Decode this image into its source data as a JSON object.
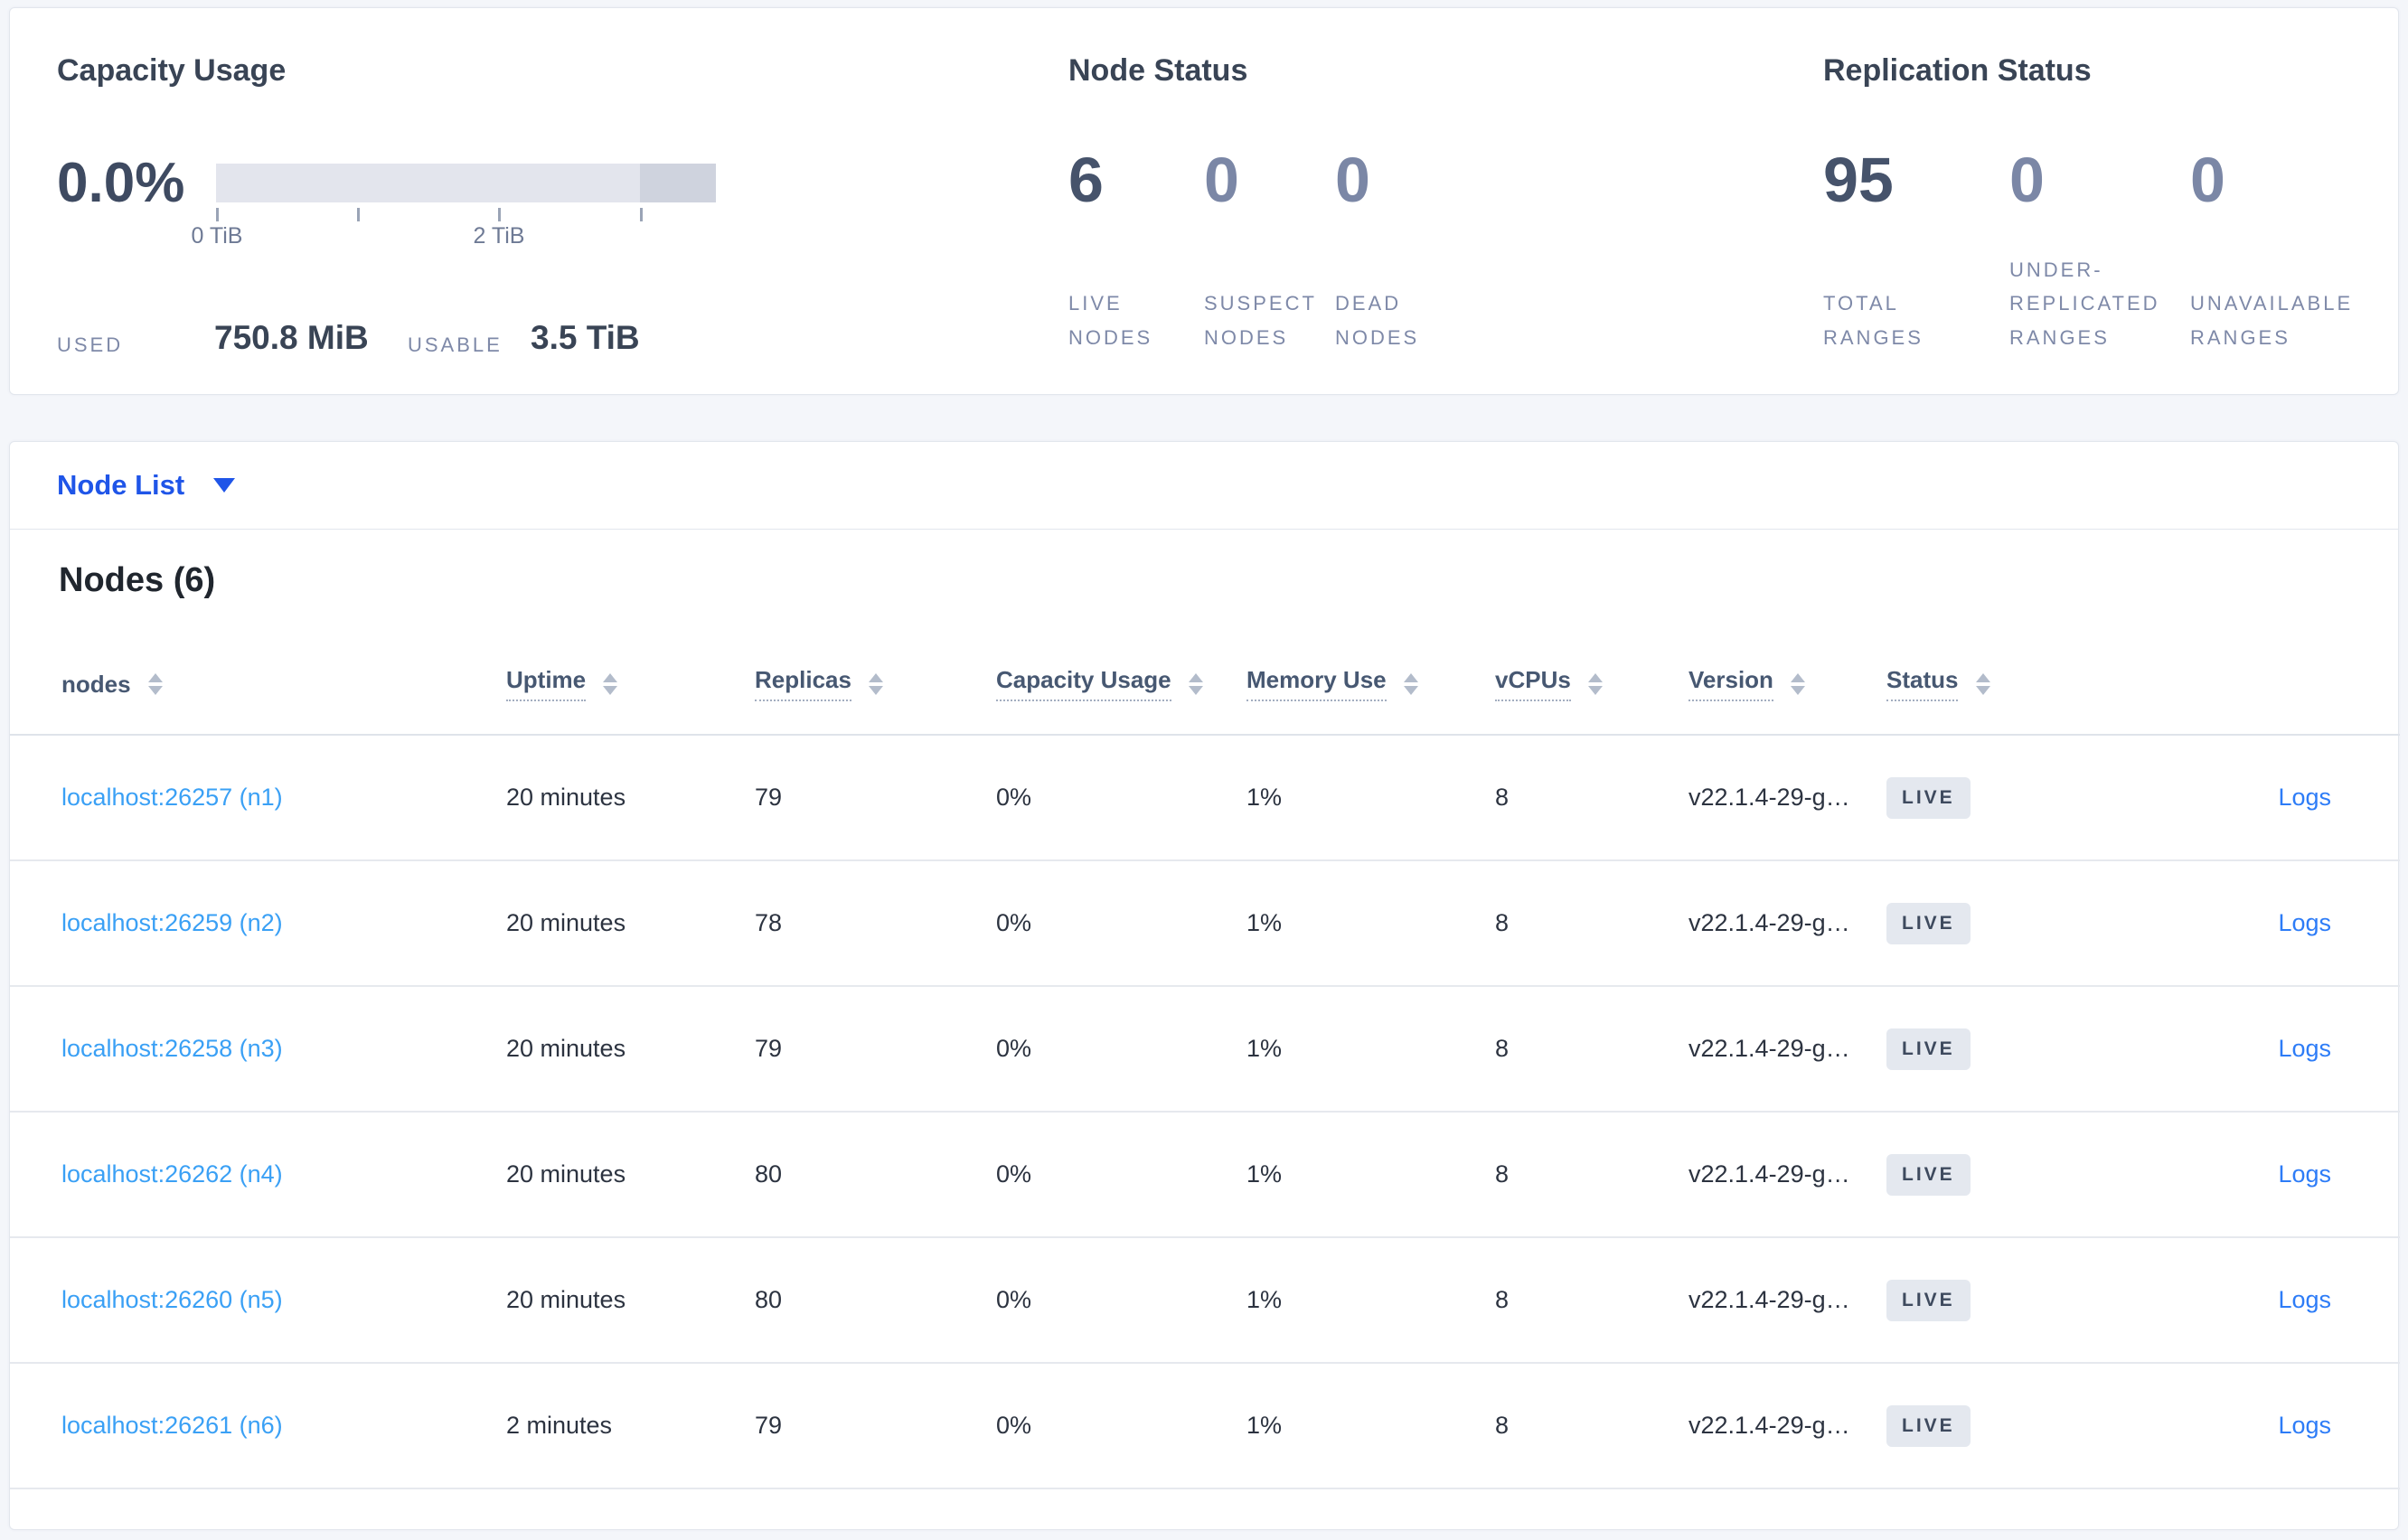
{
  "summary": {
    "capacity": {
      "title": "Capacity Usage",
      "percent": "0.0%",
      "axis_ticks": [
        "0 TiB",
        "2 TiB"
      ],
      "used_label": "USED",
      "used_value": "750.8 MiB",
      "usable_label": "USABLE",
      "usable_value": "3.5 TiB"
    },
    "node_status": {
      "title": "Node Status",
      "stats": [
        {
          "value": "6",
          "label": "LIVE NODES"
        },
        {
          "value": "0",
          "label": "SUSPECT NODES"
        },
        {
          "value": "0",
          "label": "DEAD NODES"
        }
      ]
    },
    "replication": {
      "title": "Replication Status",
      "stats": [
        {
          "value": "95",
          "label": "TOTAL RANGES"
        },
        {
          "value": "0",
          "label": "UNDER-REPLICATED RANGES"
        },
        {
          "value": "0",
          "label": "UNAVAILABLE RANGES"
        }
      ]
    }
  },
  "node_list": {
    "dropdown_label": "Node List",
    "heading": "Nodes (6)"
  },
  "table": {
    "columns": [
      "nodes",
      "Uptime",
      "Replicas",
      "Capacity Usage",
      "Memory Use",
      "vCPUs",
      "Version",
      "Status"
    ],
    "rows": [
      {
        "node": "localhost:26257 (n1)",
        "uptime": "20 minutes",
        "replicas": "79",
        "capacity": "0%",
        "memory": "1%",
        "vcpus": "8",
        "version": "v22.1.4-29-g…",
        "status": "LIVE",
        "logs_label": "Logs"
      },
      {
        "node": "localhost:26259 (n2)",
        "uptime": "20 minutes",
        "replicas": "78",
        "capacity": "0%",
        "memory": "1%",
        "vcpus": "8",
        "version": "v22.1.4-29-g…",
        "status": "LIVE",
        "logs_label": "Logs"
      },
      {
        "node": "localhost:26258 (n3)",
        "uptime": "20 minutes",
        "replicas": "79",
        "capacity": "0%",
        "memory": "1%",
        "vcpus": "8",
        "version": "v22.1.4-29-g…",
        "status": "LIVE",
        "logs_label": "Logs"
      },
      {
        "node": "localhost:26262 (n4)",
        "uptime": "20 minutes",
        "replicas": "80",
        "capacity": "0%",
        "memory": "1%",
        "vcpus": "8",
        "version": "v22.1.4-29-g…",
        "status": "LIVE",
        "logs_label": "Logs"
      },
      {
        "node": "localhost:26260 (n5)",
        "uptime": "20 minutes",
        "replicas": "80",
        "capacity": "0%",
        "memory": "1%",
        "vcpus": "8",
        "version": "v22.1.4-29-g…",
        "status": "LIVE",
        "logs_label": "Logs"
      },
      {
        "node": "localhost:26261 (n6)",
        "uptime": "2 minutes",
        "replicas": "79",
        "capacity": "0%",
        "memory": "1%",
        "vcpus": "8",
        "version": "v22.1.4-29-g…",
        "status": "LIVE",
        "logs_label": "Logs"
      }
    ]
  },
  "colors": {
    "page_bg": "#f4f6fa",
    "panel_bg": "#ffffff",
    "panel_border": "#e2e6ed",
    "title_text": "#394455",
    "stat_number_primary": "#46536b",
    "stat_number_secondary": "#7b87a6",
    "stat_label": "#7e89a8",
    "bar_track": "#e3e5ed",
    "bar_segment": "#cfd3de",
    "dropdown_blue": "#1f55e8",
    "node_link_blue": "#3aa0f5",
    "logs_link_blue": "#2d7cf7",
    "badge_bg": "#e4e8ef",
    "badge_text": "#3e4a5e",
    "row_divider": "#e6e9ee"
  }
}
